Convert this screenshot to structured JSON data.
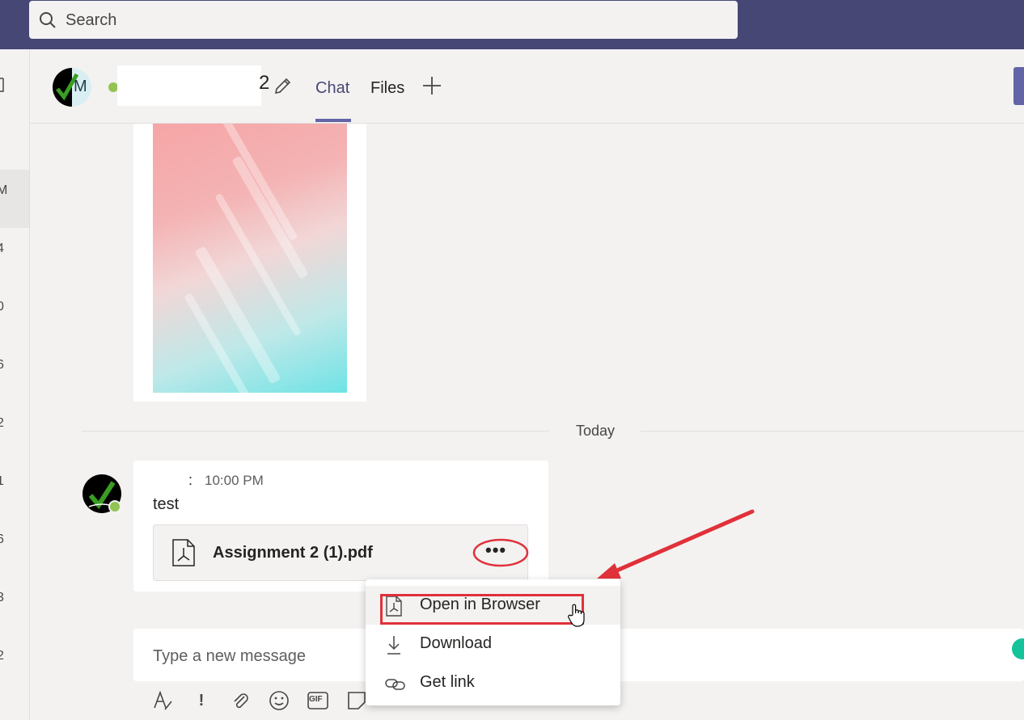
{
  "search": {
    "placeholder": "Search"
  },
  "rail": {
    "items": [
      "M",
      "4",
      "0",
      "6",
      "2",
      "1",
      "6",
      "3",
      "2"
    ]
  },
  "chat_header": {
    "avatar_letter": "M",
    "name_suffix": "2",
    "tabs": [
      {
        "label": "Chat",
        "selected": true
      },
      {
        "label": "Files",
        "selected": false
      }
    ]
  },
  "date_divider": "Today",
  "message": {
    "sender_mark": ":",
    "time": "10:00 PM",
    "text": "test",
    "attachment": {
      "name": "Assignment 2 (1).pdf"
    },
    "more_label": "•••"
  },
  "context_menu": {
    "items": [
      {
        "label": "Open in Browser",
        "icon": "pdf-file-icon"
      },
      {
        "label": "Download",
        "icon": "download-icon"
      },
      {
        "label": "Get link",
        "icon": "link-icon"
      }
    ]
  },
  "composer": {
    "placeholder": "Type a new message",
    "tools": [
      "format-icon",
      "important-icon",
      "attach-icon",
      "emoji-icon",
      "gif-icon",
      "sticker-icon"
    ],
    "gif_label": "GIF",
    "important_label": "!"
  },
  "colors": {
    "topbar": "#464775",
    "accent": "#6264a7",
    "annotation": "#e0313a",
    "presence": "#92c353"
  }
}
